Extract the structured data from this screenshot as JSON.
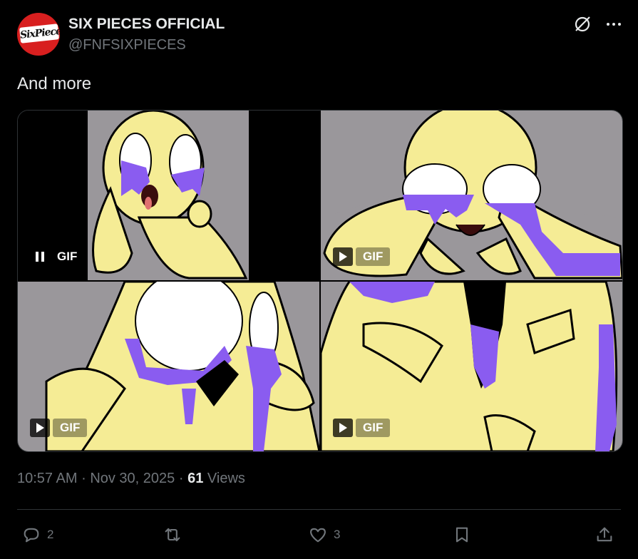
{
  "author": {
    "display_name": "SIX PIECES OFFICIAL",
    "handle": "@FNFSIXPIECES",
    "avatar_text": "SixPieces",
    "avatar_color": "#d81f1f"
  },
  "tweet": {
    "text": "And more",
    "time": "10:57 AM",
    "separator": "·",
    "date": "Nov 30, 2025",
    "views_count": "61",
    "views_label": "Views"
  },
  "media": [
    {
      "label": "GIF",
      "state": "playing",
      "control_icon": "pause-icon"
    },
    {
      "label": "GIF",
      "state": "paused",
      "control_icon": "play-icon"
    },
    {
      "label": "GIF",
      "state": "paused",
      "control_icon": "play-icon"
    },
    {
      "label": "GIF",
      "state": "paused",
      "control_icon": "play-icon"
    }
  ],
  "actions": {
    "replies": "2",
    "reposts": "",
    "likes": "3",
    "bookmarks": "",
    "share": ""
  },
  "icons": [
    "grok-icon",
    "more-icon",
    "reply-icon",
    "repost-icon",
    "like-icon",
    "bookmark-icon",
    "share-icon"
  ],
  "colors": {
    "background": "#000000",
    "text_primary": "#e7e9ea",
    "text_secondary": "#71767b",
    "character_yellow": "#f5ec95",
    "drip_purple": "#8a5cf0",
    "gif_bg_gray": "#9a979b"
  }
}
